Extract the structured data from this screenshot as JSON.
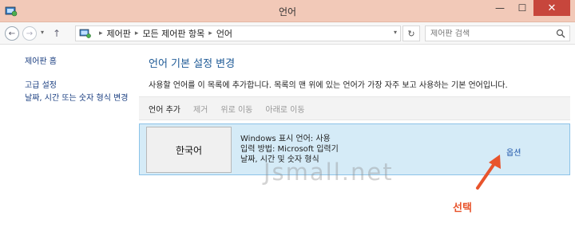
{
  "window": {
    "title": "언어",
    "minimize": "—",
    "maximize": "☐",
    "close": "✕",
    "close_color": "#c7463c"
  },
  "nav": {
    "back": "←",
    "forward": "→",
    "dropdown": "▾",
    "up": "↑",
    "breadcrumb": [
      "제어판",
      "모든 제어판 항목",
      "언어"
    ],
    "breadcrumb_sep": "▸",
    "refresh": "↻",
    "search_placeholder": "제어판 검색"
  },
  "sidebar": {
    "home": "제어판 홈",
    "advanced": "고급 설정",
    "datetime": "날짜, 시간 또는 숫자 형식 변경"
  },
  "main": {
    "title": "언어 기본 설정 변경",
    "description": "사용할 언어를 이 목록에 추가합니다. 목록의 맨 위에 있는 언어가 가장 자주 보고 사용하는 기본 언어입니다.",
    "toolbar": [
      {
        "label": "언어 추가",
        "enabled": true
      },
      {
        "label": "제거",
        "enabled": false
      },
      {
        "label": "위로 이동",
        "enabled": false
      },
      {
        "label": "아래로 이동",
        "enabled": false
      }
    ],
    "language": {
      "name": "한국어",
      "info": [
        "Windows 표시 언어: 사용",
        "입력 방법: Microsoft 입력기",
        "날짜, 시간 및 숫자 형식"
      ],
      "options": "옵션"
    }
  },
  "overlay": {
    "watermark": "Jsmall.net",
    "callout": "선택",
    "callout_color": "#e8542c"
  }
}
